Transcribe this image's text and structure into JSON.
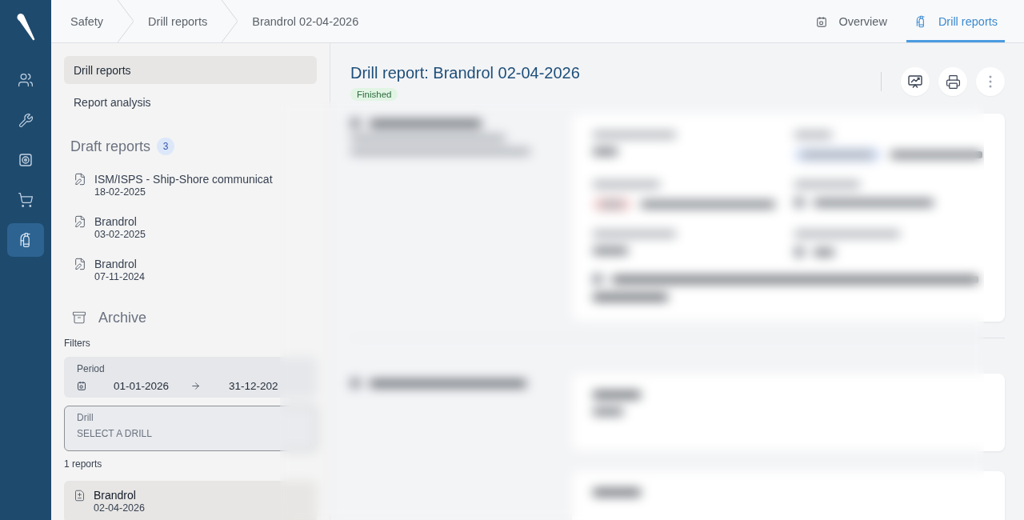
{
  "nav_rail": {
    "items": [
      {
        "selected": false
      },
      {
        "selected": false
      },
      {
        "selected": false
      },
      {
        "selected": false
      },
      {
        "selected": true
      }
    ]
  },
  "top_bar": {
    "breadcrumbs": [
      "Safety",
      "Drill reports",
      "Brandrol 02-04-2026"
    ],
    "tabs": [
      {
        "label": "Overview",
        "selected": false
      },
      {
        "label": "Drill reports",
        "selected": true
      }
    ]
  },
  "side_panel": {
    "menu": [
      {
        "label": "Drill reports",
        "selected": true
      },
      {
        "label": "Report analysis",
        "selected": false
      }
    ],
    "drafts": {
      "title": "Draft reports",
      "count": "3",
      "items": [
        {
          "title": "ISM/ISPS - Ship-Shore communicat",
          "date": "18-02-2025",
          "selected": false
        },
        {
          "title": "Brandrol",
          "date": "03-02-2025",
          "selected": false
        },
        {
          "title": "Brandrol",
          "date": "07-11-2024",
          "selected": false
        }
      ]
    },
    "archive": {
      "title": "Archive",
      "filters_label": "Filters",
      "period": {
        "label": "Period",
        "from": "01-01-2026",
        "to": "31-12-202"
      },
      "drill_filter": {
        "label": "Drill",
        "placeholder": "SELECT A DRILL"
      },
      "result_count": "1 reports",
      "reports": [
        {
          "title": "Brandrol",
          "date": "02-04-2026",
          "selected": true
        }
      ]
    }
  },
  "report": {
    "title": "Drill report: Brandrol 02-04-2026",
    "status": "Finished"
  }
}
